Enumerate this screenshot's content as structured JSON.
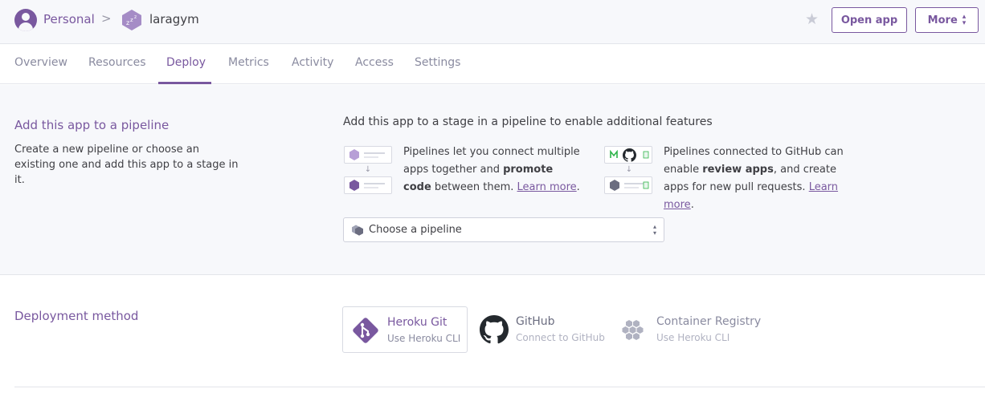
{
  "breadcrumb": {
    "account": "Personal",
    "separator": ">",
    "app_name": "laragym"
  },
  "header": {
    "open_app_label": "Open app",
    "more_label": "More"
  },
  "tabs": [
    {
      "label": "Overview",
      "active": false
    },
    {
      "label": "Resources",
      "active": false
    },
    {
      "label": "Deploy",
      "active": true
    },
    {
      "label": "Metrics",
      "active": false
    },
    {
      "label": "Activity",
      "active": false
    },
    {
      "label": "Access",
      "active": false
    },
    {
      "label": "Settings",
      "active": false
    }
  ],
  "pipeline": {
    "title": "Add this app to a pipeline",
    "description": "Create a new pipeline or choose an existing one and add this app to a stage in it.",
    "headline": "Add this app to a stage in a pipeline to enable additional features",
    "feature1": {
      "pre": "Pipelines let you connect multiple apps together and ",
      "bold": "promote code",
      "post": " between them. ",
      "link": "Learn more",
      "end": "."
    },
    "feature2": {
      "pre": "Pipelines connected to GitHub can enable ",
      "bold": "review apps",
      "post": ", and create apps for new pull requests. ",
      "link": "Learn more",
      "end": "."
    },
    "select_value": "Choose a pipeline"
  },
  "deployment": {
    "title": "Deployment method",
    "methods": [
      {
        "name": "Heroku Git",
        "sub": "Use Heroku CLI",
        "icon": "git-icon",
        "selected": true
      },
      {
        "name": "GitHub",
        "sub": "Connect to GitHub",
        "icon": "github-icon",
        "selected": false
      },
      {
        "name": "Container Registry",
        "sub": "Use Heroku CLI",
        "icon": "container-registry-icon",
        "selected": false
      }
    ]
  },
  "colors": {
    "accent": "#79589f",
    "muted": "#8a8ba0",
    "background": "#f7f8fb"
  }
}
